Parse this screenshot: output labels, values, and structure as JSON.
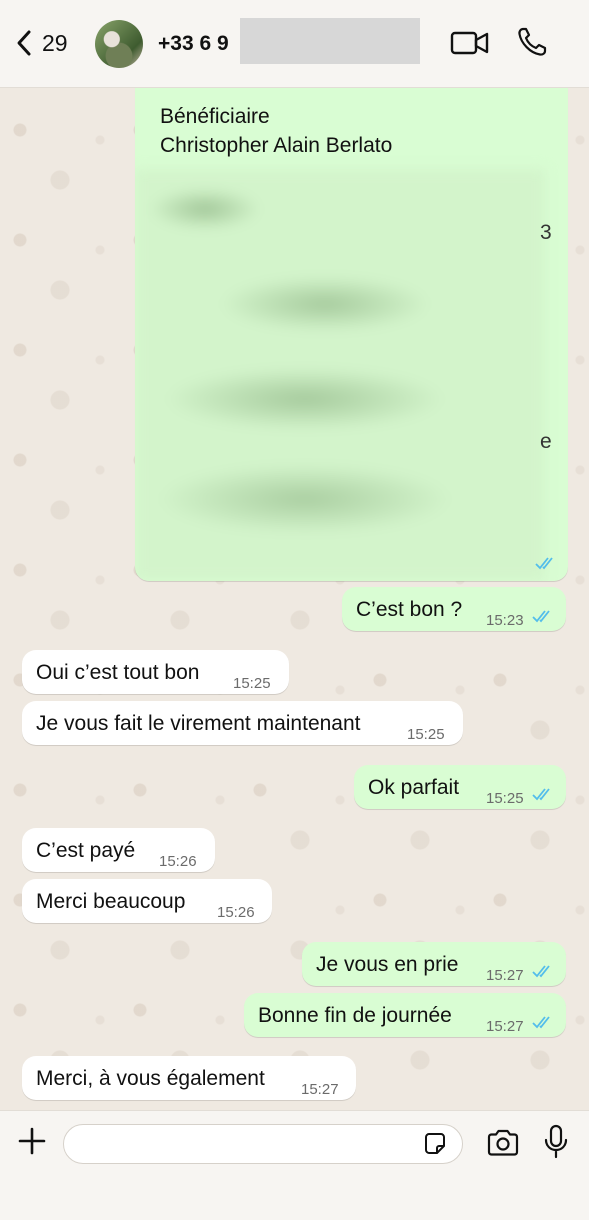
{
  "header": {
    "back_count": "29",
    "contact_name": "+33 6 9"
  },
  "image_message": {
    "line1": "Bénéficiaire",
    "line2": "Christopher Alain Berlato",
    "fragment1": "3",
    "fragment2": "e"
  },
  "messages": [
    {
      "dir": "out",
      "text": "C’est bon ?",
      "time": "15:23",
      "ticks": "read"
    },
    {
      "dir": "in",
      "text": "Oui c’est tout bon",
      "time": "15:25"
    },
    {
      "dir": "in",
      "text": "Je vous fait le virement maintenant",
      "time": "15:25"
    },
    {
      "dir": "out",
      "text": "Ok parfait",
      "time": "15:25",
      "ticks": "read"
    },
    {
      "dir": "in",
      "text": "C’est payé",
      "time": "15:26"
    },
    {
      "dir": "in",
      "text": "Merci beaucoup",
      "time": "15:26"
    },
    {
      "dir": "out",
      "text": "Je vous en prie",
      "time": "15:27",
      "ticks": "read"
    },
    {
      "dir": "out",
      "text": "Bonne fin de journée",
      "time": "15:27",
      "ticks": "read"
    },
    {
      "dir": "in",
      "text": "Merci, à vous également",
      "time": "15:27"
    }
  ],
  "composer": {
    "placeholder": ""
  },
  "icons": {
    "back": "chevron-left-icon",
    "video": "video-camera-icon",
    "phone": "phone-icon",
    "plus": "plus-icon",
    "sticker": "sticker-icon",
    "camera": "camera-icon",
    "mic": "microphone-icon"
  },
  "colors": {
    "outgoing_bubble": "#d9fdd3",
    "incoming_bubble": "#ffffff",
    "read_ticks": "#53bdeb",
    "wallpaper": "#efe9e1"
  }
}
